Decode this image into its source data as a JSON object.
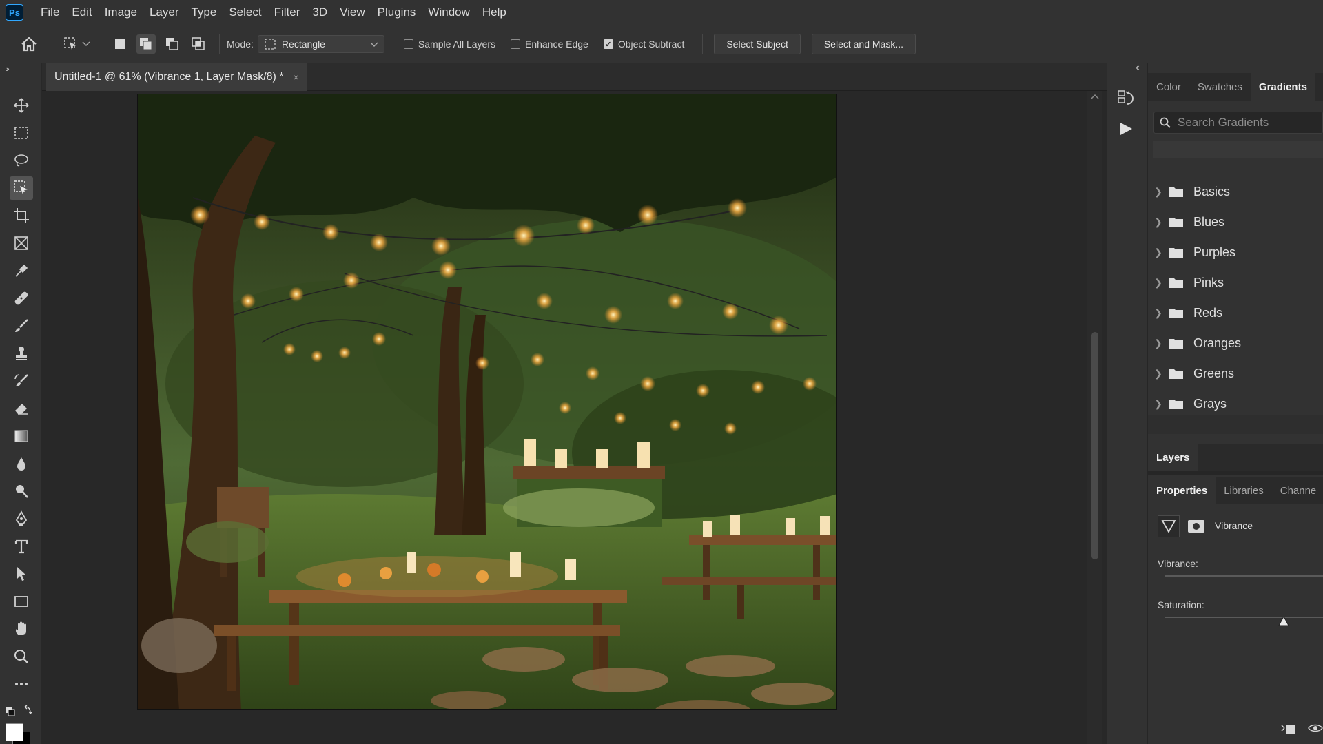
{
  "app": {
    "logo": "Ps",
    "menu": [
      "File",
      "Edit",
      "Image",
      "Layer",
      "Type",
      "Select",
      "Filter",
      "3D",
      "View",
      "Plugins",
      "Window",
      "Help"
    ]
  },
  "options": {
    "mode_label": "Mode:",
    "mode_value": "Rectangle",
    "sample_all_layers": "Sample All Layers",
    "sample_all_layers_checked": false,
    "enhance_edge": "Enhance Edge",
    "enhance_edge_checked": false,
    "object_subtract": "Object Subtract",
    "object_subtract_checked": true,
    "select_subject": "Select Subject",
    "select_and_mask": "Select and Mask..."
  },
  "document": {
    "tab_title": "Untitled-1 @ 61% (Vibrance 1, Layer Mask/8) *",
    "close_glyph": "×"
  },
  "tools": [
    "move-tool",
    "marquee-tool",
    "lasso-tool",
    "object-selection-tool",
    "crop-tool",
    "frame-tool",
    "eyedropper-tool",
    "healing-tool",
    "brush-tool",
    "stamp-tool",
    "history-brush-tool",
    "eraser-tool",
    "gradient-tool",
    "blur-tool",
    "dodge-tool",
    "pen-tool",
    "type-tool",
    "path-selection-tool",
    "rectangle-tool",
    "hand-tool",
    "zoom-tool",
    "more-tools"
  ],
  "gradients_panel": {
    "tabs": [
      "Color",
      "Swatches",
      "Gradients"
    ],
    "active_tab": "Gradients",
    "search_placeholder": "Search Gradients",
    "folders": [
      "Basics",
      "Blues",
      "Purples",
      "Pinks",
      "Reds",
      "Oranges",
      "Greens",
      "Grays"
    ]
  },
  "layers_panel": {
    "tab": "Layers"
  },
  "properties_panel": {
    "tabs": [
      "Properties",
      "Libraries",
      "Channe"
    ],
    "active_tab": "Properties",
    "adjustment_name": "Vibrance",
    "vibrance_label": "Vibrance:",
    "saturation_label": "Saturation:",
    "saturation_level": 0.75
  },
  "colors": {
    "accent": "#31a8ff",
    "ui_dark": "#323232",
    "canvas_bg": "#282828"
  }
}
